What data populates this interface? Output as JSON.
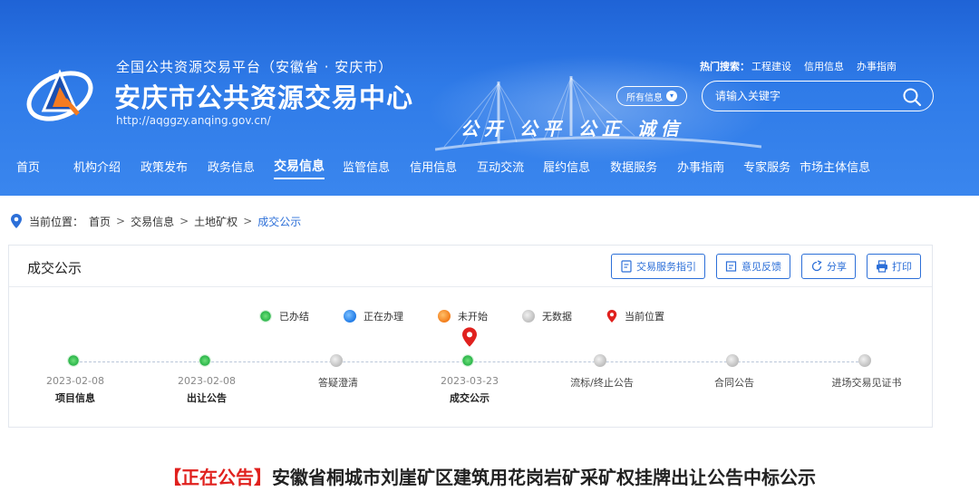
{
  "header": {
    "subtitle": "全国公共资源交易平台（安徽省 · 安庆市）",
    "title": "安庆市公共资源交易中心",
    "url": "http://aqggzy.anqing.gov.cn/",
    "slogan": "公开 公平 公正 诚信",
    "hot_label": "热门搜索：",
    "hot_items": [
      "工程建设",
      "信用信息",
      "办事指南"
    ],
    "search_scope": "所有信息",
    "search_placeholder": "请输入关键字",
    "logo_icon": "aq-logo-icon",
    "search_icon": "search-icon"
  },
  "nav": [
    {
      "label": "首页"
    },
    {
      "label": "机构介绍"
    },
    {
      "label": "政策发布"
    },
    {
      "label": "政务信息"
    },
    {
      "label": "交易信息",
      "active": true
    },
    {
      "label": "监管信息"
    },
    {
      "label": "信用信息"
    },
    {
      "label": "互动交流"
    },
    {
      "label": "履约信息"
    },
    {
      "label": "数据服务"
    },
    {
      "label": "办事指南"
    },
    {
      "label": "专家服务"
    },
    {
      "label": "市场主体信息"
    }
  ],
  "breadcrumb": {
    "label": "当前位置：",
    "items": [
      "首页",
      "交易信息",
      "土地矿权",
      "成交公示"
    ],
    "separator": ">"
  },
  "panel": {
    "title": "成交公示",
    "buttons": [
      "交易服务指引",
      "意见反馈",
      "分享",
      "打印"
    ],
    "legend": [
      "已办结",
      "正在办理",
      "未开始",
      "无数据",
      "当前位置"
    ],
    "steps": [
      {
        "date": "2023-02-08",
        "name": "项目信息",
        "status": "done"
      },
      {
        "date": "2023-02-08",
        "name": "出让公告",
        "status": "done"
      },
      {
        "date": "",
        "name": "答疑澄清",
        "status": "nodata"
      },
      {
        "date": "2023-03-23",
        "name": "成交公示",
        "status": "done",
        "current": true
      },
      {
        "date": "",
        "name": "流标/终止公告",
        "status": "nodata"
      },
      {
        "date": "",
        "name": "合同公告",
        "status": "nodata"
      },
      {
        "date": "",
        "name": "进场交易见证书",
        "status": "nodata"
      }
    ]
  },
  "notice": {
    "tag": "【正在公告】",
    "title": "安徽省桐城市刘崖矿区建筑用花岗岩矿采矿权挂牌出让公告中标公示"
  },
  "colors": {
    "brand_blue": "#2c6fd8",
    "banner_blue": "#2f7be8",
    "alert_red": "#e0211e",
    "done_green": "#2bb54a"
  }
}
